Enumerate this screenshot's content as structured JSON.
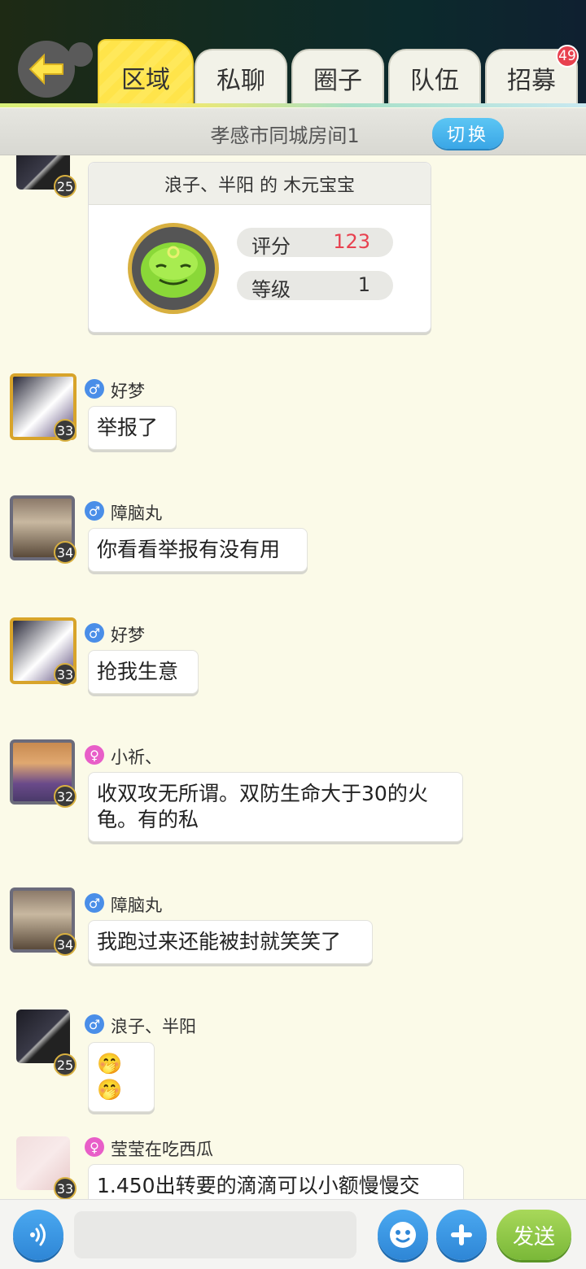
{
  "header": {
    "tabs": [
      {
        "label": "区域",
        "active": true
      },
      {
        "label": "私聊",
        "active": false
      },
      {
        "label": "圈子",
        "active": false
      },
      {
        "label": "队伍",
        "active": false
      },
      {
        "label": "招募",
        "active": false
      }
    ],
    "recruit_badge": "49"
  },
  "room": {
    "title": "孝感市同城房间1",
    "switch_label": "切换"
  },
  "pet_card": {
    "sender_level": "25",
    "title": "浪子、半阳 的 木元宝宝",
    "score_label": "评分",
    "score_value": "123",
    "grade_label": "等级",
    "grade_value": "1"
  },
  "messages": [
    {
      "gender": "♂",
      "nick": "好梦",
      "level": "33",
      "text": "举报了"
    },
    {
      "gender": "♂",
      "nick": "障脑丸",
      "level": "34",
      "text": "你看看举报有没有用"
    },
    {
      "gender": "♂",
      "nick": "好梦",
      "level": "33",
      "text": "抢我生意"
    },
    {
      "gender": "♀",
      "nick": "小祈、",
      "level": "32",
      "text": "收双攻无所谓。双防生命大于30的火龟。有的私"
    },
    {
      "gender": "♂",
      "nick": "障脑丸",
      "level": "34",
      "text": "我跑过来还能被封就笑笑了"
    },
    {
      "gender": "♂",
      "nick": "浪子、半阳",
      "level": "25",
      "text": "🤭🤭"
    },
    {
      "gender": "♀",
      "nick": "莹莹在吃西瓜",
      "level": "33",
      "text": "1.450出转要的滴滴可以小额慢慢交"
    }
  ],
  "composer": {
    "input_value": "",
    "send_label": "发送"
  },
  "colors": {
    "accent_yellow": "#ffe44a",
    "male_blue": "#4a8ee8",
    "female_pink": "#e85ec8",
    "score_red": "#e8414f",
    "send_green": "#7ab838"
  }
}
